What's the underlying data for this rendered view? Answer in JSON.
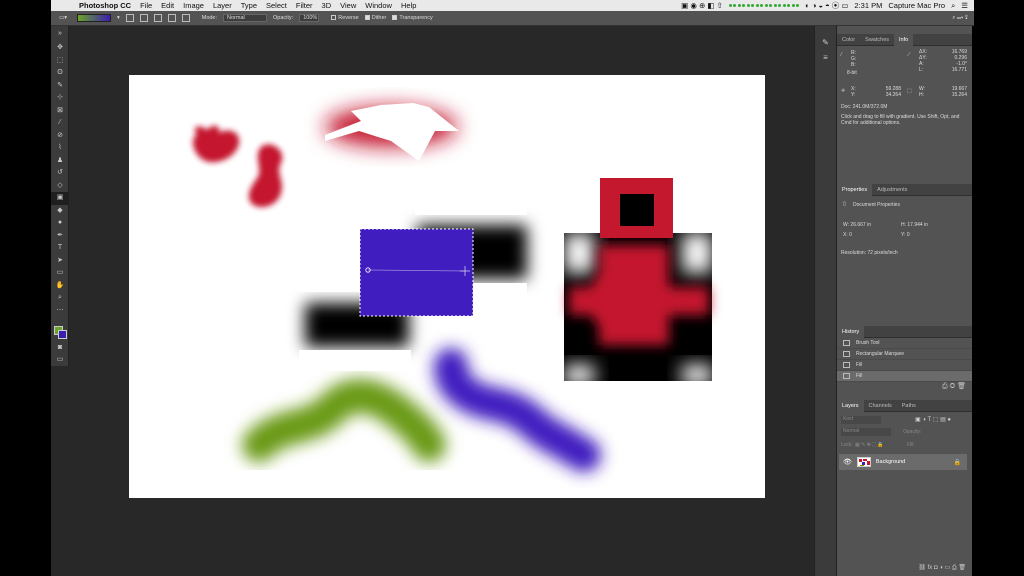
{
  "menubar": {
    "app_name": "Photoshop CC",
    "items": [
      "File",
      "Edit",
      "Image",
      "Layer",
      "Type",
      "Select",
      "Filter",
      "3D",
      "View",
      "Window",
      "Help"
    ],
    "clock": "2:31 PM",
    "user": "Capture Mac Pro"
  },
  "options_bar": {
    "mode_label": "Mode:",
    "mode_value": "Normal",
    "opacity_label": "Opacity:",
    "opacity_value": "100%",
    "reverse": "Reverse",
    "dither": "Dither",
    "transparency": "Transparency",
    "colors": {
      "gradient_start": "#6aa52a",
      "gradient_end": "#3b1fb0"
    }
  },
  "info_panel": {
    "tabs": [
      "Color",
      "Swatches",
      "Info"
    ],
    "r_label": "R:",
    "g_label": "G:",
    "b_label": "B:",
    "bit_depth": "8-bit",
    "dx_label": "ΔX:",
    "dx": "16.769",
    "dy_label": "ΔY:",
    "dy": "0.296",
    "a_label": "A:",
    "a": "-1.0°",
    "l_label": "L:",
    "l": "16.771",
    "x_label": "X:",
    "x": "59.288",
    "y_label": "Y:",
    "y": "34.264",
    "w_label": "W:",
    "w": "19.667",
    "h_label": "H:",
    "h": "15.264",
    "doc": "Doc: 241.0M/372.0M",
    "hint": "Click and drag to fill with gradient. Use Shift, Opt, and Cmd for additional options."
  },
  "properties_panel": {
    "tabs": [
      "Properties",
      "Adjustments"
    ],
    "title": "Document Properties",
    "w": "W: 26.667 in",
    "h": "H: 17.944 in",
    "x": "X: 0",
    "y": "Y: 0",
    "resolution": "Resolution: 72 pixels/inch"
  },
  "history_panel": {
    "tab": "History",
    "items": [
      "Brush Tool",
      "Rectangular Marquee",
      "Fill",
      "Fill"
    ]
  },
  "layers_panel": {
    "tabs": [
      "Layers",
      "Channels",
      "Paths"
    ],
    "search_placeholder": "Kind",
    "blend": "Normal",
    "opacity_label": "Opacity:",
    "lock_label": "Lock:",
    "fill_label": "Fill:",
    "layer_name": "Background"
  },
  "canvas": {
    "colors": {
      "red": "#c4182f",
      "green": "#6a9a14",
      "purple": "#3f1dbf",
      "black": "#000000"
    }
  }
}
